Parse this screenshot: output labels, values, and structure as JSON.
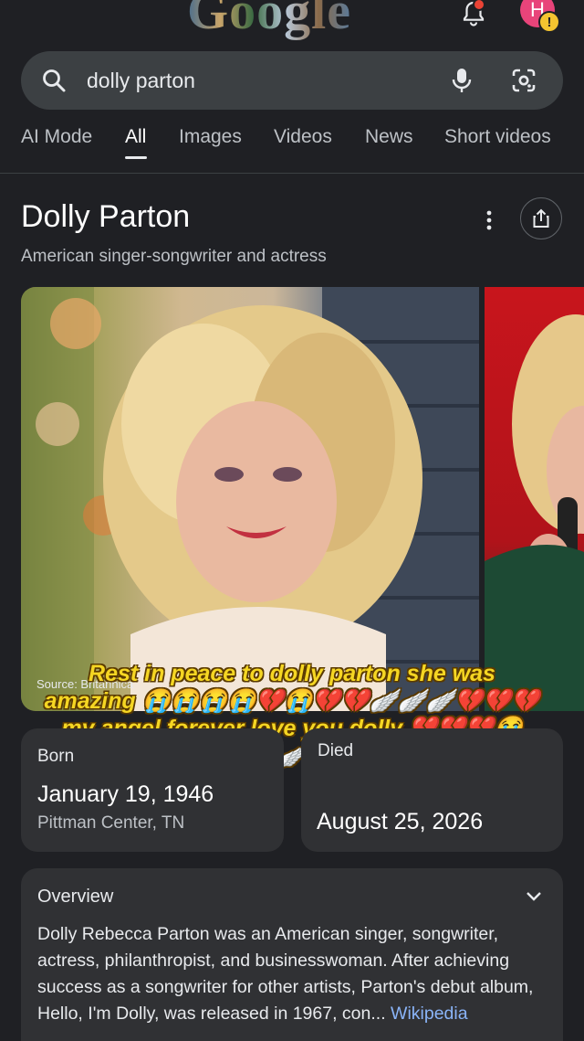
{
  "header": {
    "logo_text": "Google",
    "avatar_initial": "H",
    "warning_mark": "!"
  },
  "search": {
    "query": "dolly parton"
  },
  "tabs": [
    {
      "label": "AI Mode"
    },
    {
      "label": "All",
      "active": true
    },
    {
      "label": "Images"
    },
    {
      "label": "Videos"
    },
    {
      "label": "News"
    },
    {
      "label": "Short videos"
    }
  ],
  "panel": {
    "title": "Dolly Parton",
    "subtitle": "American singer-songwriter and actress",
    "image_source": "Source: Britannica"
  },
  "overlay_caption": {
    "line1": "Rest in peace to dolly parton she was",
    "line2": "amazing 😭😭😭😭💔😭💔💔🪽🪽🪽💔💔💔",
    "line3": "my angel forever love you dolly 💔💔💔😭",
    "line4": "😭😭🪽🪽🪽"
  },
  "born": {
    "label": "Born",
    "date": "January 19, 1946",
    "place": "Pittman Center, TN"
  },
  "died": {
    "label": "Died",
    "date": "August 25, 2026"
  },
  "overview": {
    "title": "Overview",
    "text": "Dolly Rebecca Parton was an American singer, songwriter, actress, philanthropist, and businesswoman. After achieving success as a songwriter for other artists, Parton's debut album, Hello, I'm Dolly, was released in 1967, con...",
    "link_label": "Wikipedia"
  },
  "colors": {
    "background": "#1f2024",
    "card": "#303134",
    "link": "#8ab4f8",
    "caption": "#f5d623"
  }
}
